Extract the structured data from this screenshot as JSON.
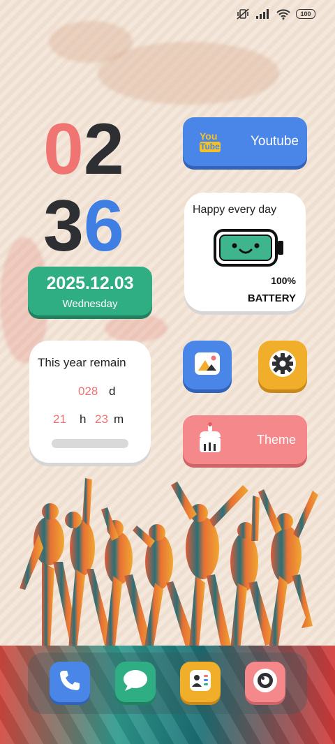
{
  "status_bar": {
    "icons": [
      "mute-vibrate-icon",
      "signal-icon",
      "wifi-icon",
      "battery-icon"
    ],
    "battery_text": "100"
  },
  "clock": {
    "hour_a": "0",
    "hour_b": "2",
    "min_a": "3",
    "min_b": "6"
  },
  "date_widget": {
    "date": "2025.12.03",
    "weekday": "Wednesday"
  },
  "youtube_app": {
    "label": "Youtube",
    "logo_top": "You",
    "logo_bottom": "Tube"
  },
  "battery_widget": {
    "title": "Happy every day",
    "percent": "100%",
    "label": "BATTERY"
  },
  "year_widget": {
    "title": "This year remain",
    "days": "028",
    "days_unit": "d",
    "hours": "21",
    "hours_unit": "h",
    "minutes": "23",
    "minutes_unit": "m"
  },
  "apps": {
    "gallery_icon": "gallery-icon",
    "settings_icon": "gear-icon",
    "theme_label": "Theme"
  },
  "dock": [
    "phone-icon",
    "message-icon",
    "contacts-icon",
    "camera-icon"
  ],
  "colors": {
    "pink": "#f07472",
    "blue": "#4a86e8",
    "green": "#2fae84",
    "yellow": "#f0ae2a",
    "dark": "#2d2f33"
  }
}
